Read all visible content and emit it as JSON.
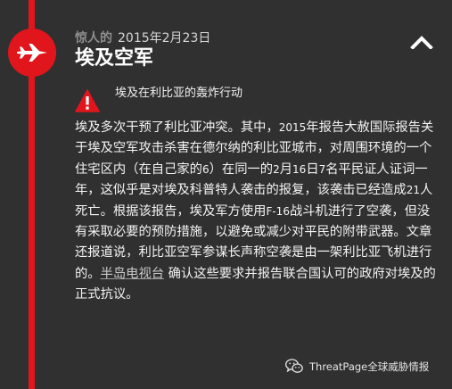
{
  "event": {
    "category": "惊人的",
    "date": "2015年2月23日",
    "title": "埃及空军",
    "subheading": "埃及在利比亚的轰炸行动",
    "body": {
      "part1": "埃及多次干预了利比亚冲突。其中，",
      "year": "2015",
      "part2": "年报告大赦国际报告关于埃及空军攻击杀害在德尔纳的利比亚城市，对周围环境的一个住宅区内（在自己家的",
      "num1": "6",
      "part3": "）在同一的",
      "num2": "2",
      "part4": "月",
      "num3": "16",
      "part5": "日",
      "num4": "7",
      "part6": "名平民证人证词一年，这似乎是对埃及科普特人袭击的报复，该袭击已经造成",
      "num5": "21",
      "part7": "人死亡。根据该报告，埃及军方使用",
      "f16": "F-16",
      "part8": "战斗机进行了空袭，但没有采取必要的预防措施，以避免或减少对平民的附带武器。文章还报道说，利比亚空军参谋长声称空袭是由一架利比亚飞机进行的。",
      "link_text": "半岛电视台",
      "part9": " 确认这些要求并报告联合国认可的政府对埃及的正式抗议。"
    }
  },
  "watermark": {
    "text": "ThreatPage全球威胁情报",
    "icon": "wechat-icon"
  },
  "icons": {
    "badge": "fighter-jet-icon",
    "collapse": "chevron-up-icon",
    "warning": "warning-icon"
  },
  "colors": {
    "background": "#303030",
    "accent_red": "#e1161d",
    "text": "#f4f4f4",
    "muted": "#8e8e8e"
  }
}
